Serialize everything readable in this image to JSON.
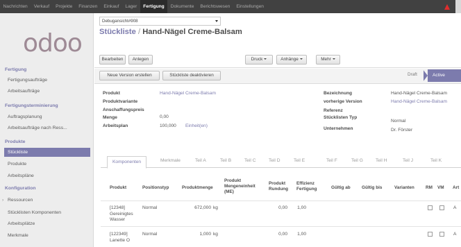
{
  "topbar": {
    "menu": [
      "Nachrichten",
      "Verkauf",
      "Projekte",
      "Finanzen",
      "Einkauf",
      "Lager",
      "Fertigung",
      "Dokumente",
      "Berichtswesen",
      "Einstellungen"
    ],
    "active": "Fertigung"
  },
  "sidebar": {
    "logo": "odoo",
    "sections": [
      {
        "label": "Fertigung",
        "items": [
          "Fertigungsaufträge",
          "Arbeitsaufträge"
        ]
      },
      {
        "label": "Fertigungsterminierung",
        "items": [
          "Auftragsplanung",
          "Arbeitsaufträge nach Ress..."
        ]
      },
      {
        "label": "Produkte",
        "items": [
          "Stückliste",
          "Produkte",
          "Arbeitspläne"
        ]
      },
      {
        "label": "Konfiguration",
        "items": [
          "Ressourcen",
          "Stücklisten Komponenten",
          "Arbeitsplätze",
          "Merkmale"
        ]
      }
    ],
    "active_item": "Stückliste"
  },
  "header": {
    "view_select": "Debugansicht#908",
    "breadcrumb_parent": "Stückliste",
    "breadcrumb_sep": "/",
    "breadcrumb_current": "Hand-Nägel Creme-Balsam"
  },
  "toolbar": {
    "edit": "Bearbeiten",
    "create": "Anlegen",
    "print": "Druck",
    "attachments": "Anhänge",
    "more": "Mehr"
  },
  "statusbar": {
    "new_version": "Neue Version erstellen",
    "deactivate": "Stückliste deaktivieren",
    "stage_draft": "Draft",
    "stage_active": "Active"
  },
  "form": {
    "left": [
      {
        "label": "Produkt",
        "value": "Hand-Nägel Creme-Balsam"
      },
      {
        "label": "Produktvariante",
        "value": ""
      },
      {
        "label": "Anschaffungspreis",
        "value": "0,00"
      },
      {
        "label": "Menge",
        "value": "100,000",
        "unit": "Einheit(en)"
      },
      {
        "label": "Arbeitsplan",
        "value": ""
      }
    ],
    "right": [
      {
        "label": "Bezeichnung",
        "value": "Hand-Nägel Creme-Balsam"
      },
      {
        "label": "vorherige Version",
        "value": "Hand-Nägel Creme-Balsam"
      },
      {
        "label": "Referenz",
        "value": ""
      },
      {
        "label": "Stücklisten Typ",
        "value": "Normal"
      },
      {
        "label": "Unternehmen",
        "value": "Dr. Förster"
      }
    ]
  },
  "tabs": [
    "Komponenten",
    "Merkmale",
    "Teil A",
    "Teil B",
    "Teil C",
    "Teil D",
    "Teil E",
    "Teil F",
    "Teil G",
    "Teil H",
    "Teil J",
    "Teil K"
  ],
  "active_tab": "Komponenten",
  "table": {
    "headers": [
      "Produkt",
      "Positionstyp",
      "Produktmenge",
      "Produkt Mengeneinheit (ME)",
      "Produkt Rundung",
      "Effizienz Fertigung",
      "Gültig ab",
      "Gültig bis",
      "Varianten",
      "RM",
      "VM",
      "Art"
    ],
    "rows": [
      {
        "product": "[12348] Gereinigtes Wasser",
        "type": "Normal",
        "qty": "672,000",
        "uom": "kg",
        "rounding": "0,00",
        "efficiency": "1,00",
        "art": "A"
      },
      {
        "product": "[122349] Lanette O",
        "type": "Normal",
        "qty": "1,000",
        "uom": "kg",
        "rounding": "0,00",
        "efficiency": "1,00",
        "art": "A"
      }
    ]
  },
  "colors": {
    "accent": "#7c7bad",
    "topbar": "#414141",
    "sidebar": "#ededed",
    "alert": "#e02d2d"
  }
}
